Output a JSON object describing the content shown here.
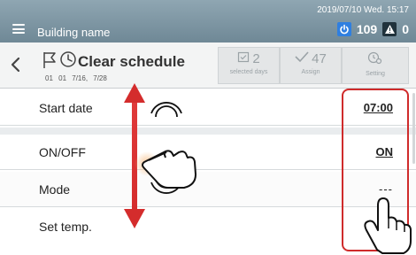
{
  "topbar": {
    "building_name": "Building name",
    "datetime": "2019/07/10 Wed. 15:17",
    "power_count": "109",
    "warning_count": "0"
  },
  "header": {
    "title": "Clear schedule",
    "subline": "01 01 7/16, 7/28",
    "selected_days_count": "2",
    "selected_days_label": "selected days",
    "assign_count": "47",
    "assign_label": "Assign",
    "setting_label": "Setting"
  },
  "rows": [
    {
      "label": "Start date",
      "value": "07:00"
    },
    {
      "label": "ON/OFF",
      "value": "ON"
    },
    {
      "label": "Mode",
      "value": "---"
    },
    {
      "label": "Set temp.",
      "value": ""
    }
  ],
  "colors": {
    "highlight": "#cf2b2b",
    "power_icon": "#2f7fe0",
    "topbar": "#7f97a4"
  },
  "icons": [
    "menu-icon",
    "power-icon",
    "warning-icon",
    "back-icon",
    "flag-icon",
    "clock-icon",
    "calendar-check-icon",
    "checkmark-icon",
    "clock-gear-icon",
    "vertical-arrow-icon",
    "swipe-hand-icon",
    "tap-hand-icon"
  ]
}
